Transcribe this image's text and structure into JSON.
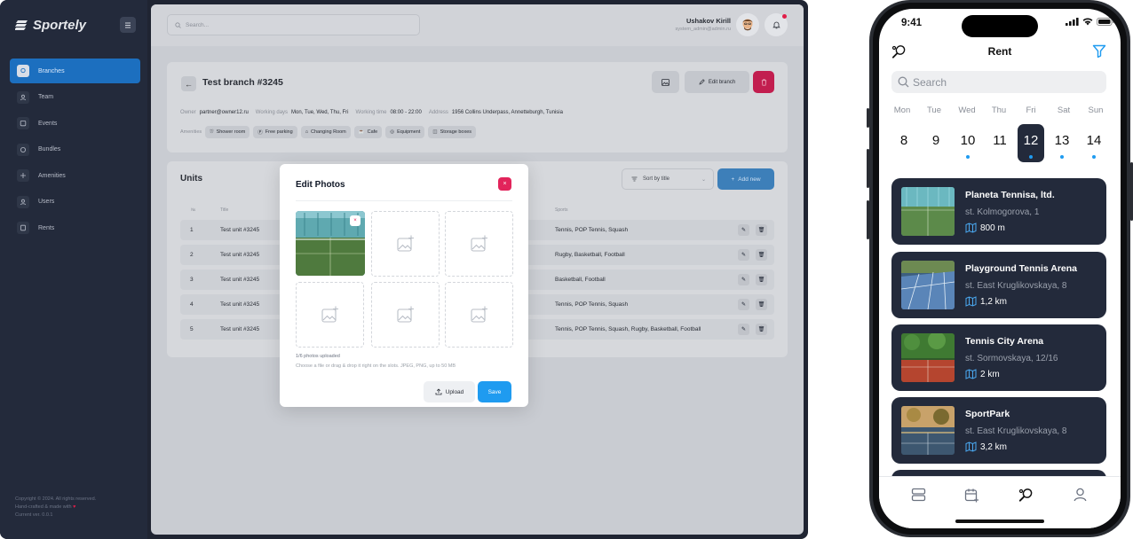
{
  "sidebar": {
    "brand": "Sportely",
    "items": [
      {
        "label": "Branches",
        "icon": "map-pin-icon",
        "active": true
      },
      {
        "label": "Team",
        "icon": "user-icon"
      },
      {
        "label": "Events",
        "icon": "calendar-icon"
      },
      {
        "label": "Bundles",
        "icon": "package-icon"
      },
      {
        "label": "Amenities",
        "icon": "sparkle-icon"
      },
      {
        "label": "Users",
        "icon": "users-icon"
      },
      {
        "label": "Rents",
        "icon": "receipt-icon"
      }
    ],
    "footer": {
      "copyright": "Copyright © 2024. All rights reserved.",
      "made_with": "Hand-crafted & made with",
      "heart": "♥",
      "version": "Current ver. 0.0.1"
    }
  },
  "topbar": {
    "search_placeholder": "Search...",
    "user_name": "Ushakov Kirill",
    "user_email": "system_admin@admin.ru"
  },
  "branch": {
    "title": "Test branch #3245",
    "edit_label": "Edit branch",
    "meta": {
      "owner_label": "Owner",
      "owner": "partner@owner12.ru",
      "days_label": "Working days",
      "days": "Mon, Tue, Wed, Thu, Fri",
      "time_label": "Working time",
      "time": "08:00 - 22:00",
      "address_label": "Address",
      "address": "1956 Collins Underpass, Annetteburgh, Tunisia"
    },
    "amenities_label": "Amenities",
    "amenities": [
      "Shower room",
      "Free parking",
      "Changing Room",
      "Cafe",
      "Equipment",
      "Storage boxes"
    ]
  },
  "units": {
    "title": "Units",
    "sort_label": "Sort by title",
    "add_label": "Add new",
    "columns": {
      "no": "№",
      "title": "Title",
      "sports": "Sports"
    },
    "rows": [
      {
        "no": "1",
        "title": "Test unit #3245",
        "sports": "Tennis, POP Tennis, Squash"
      },
      {
        "no": "2",
        "title": "Test unit #3245",
        "sports": "Rugby, Basketball, Football"
      },
      {
        "no": "3",
        "title": "Test unit #3245",
        "sports": "Basketball, Football"
      },
      {
        "no": "4",
        "title": "Test unit #3245",
        "sports": "Tennis, POP Tennis, Squash"
      },
      {
        "no": "5",
        "title": "Test unit #3245",
        "sports": "Tennis, POP Tennis, Squash, Rugby, Basketball, Football"
      }
    ]
  },
  "modal": {
    "title": "Edit Photos",
    "close": "×",
    "photo_remove": "×",
    "count": "1/6 photos uploaded",
    "hint": "Choose a file or drag & drop it right on the slots. JPEG, PNG, up to 50 MB",
    "upload_label": "Upload",
    "save_label": "Save"
  },
  "phone": {
    "time": "9:41",
    "title": "Rent",
    "search_placeholder": "Search",
    "weekdays": [
      "Mon",
      "Tue",
      "Wed",
      "Thu",
      "Fri",
      "Sat",
      "Sun"
    ],
    "days": [
      "8",
      "9",
      "10",
      "11",
      "12",
      "13",
      "14"
    ],
    "selected_day": "12",
    "venues": [
      {
        "name": "Planeta Tennisa, ltd.",
        "address": "st. Kolmogorova, 1",
        "distance": "800 m"
      },
      {
        "name": "Playground Tennis Arena",
        "address": "st. East Kruglikovskaya, 8",
        "distance": "1,2 km"
      },
      {
        "name": "Tennis City Arena",
        "address": "st. Sormovskaya, 12/16",
        "distance": "2 km"
      },
      {
        "name": "SportPark",
        "address": "st. East Kruglikovskaya, 8",
        "distance": "3,2 km"
      }
    ]
  },
  "colors": {
    "accent": "#1f9bf0",
    "sidebar_bg": "#232a3b",
    "danger": "#e2245b"
  }
}
